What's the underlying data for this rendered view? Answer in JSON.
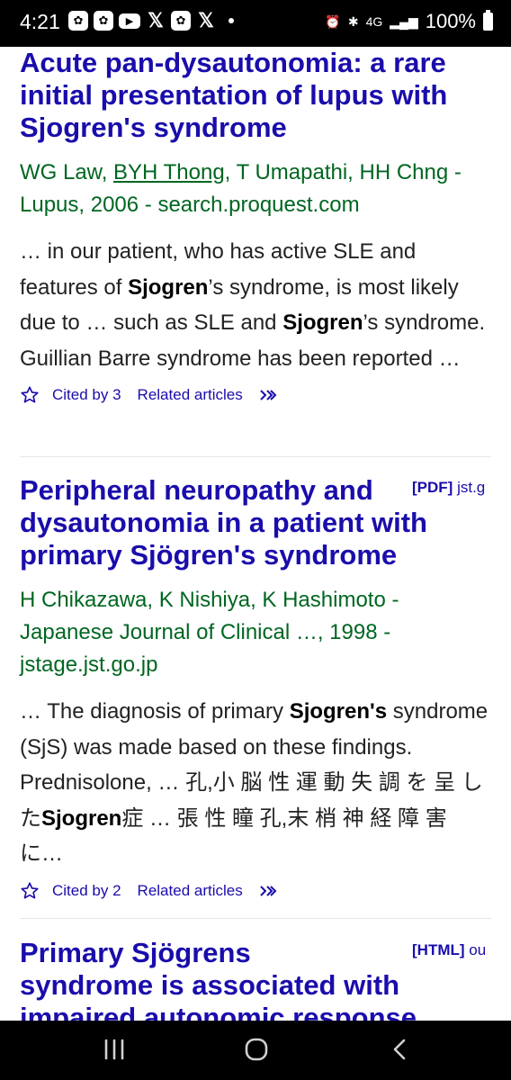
{
  "status": {
    "time": "4:21",
    "network": "4G",
    "battery": "100%"
  },
  "results": [
    {
      "title_parts": [
        "Acute pan-",
        "dysautonomia",
        ": a rare initial presentation of lupus with ",
        "Sjogren's",
        " syndrome"
      ],
      "authors_pre": "WG Law, ",
      "authors_link": "BYH Thong",
      "authors_post": ", T Umapathi, HH Chng - Lupus, 2006 - search.proquest.com",
      "snippet_parts": [
        "… in our patient, who has active SLE and features of ",
        "Sjogren",
        "’s syndrome, is most likely due to … such as SLE and ",
        "Sjogren",
        "’s syndrome. Guillian Barre syndrome has been reported …"
      ],
      "cited": "Cited by 3",
      "related": "Related articles"
    },
    {
      "tag_type": "[PDF]",
      "tag_source": "jst.g",
      "title_parts": [
        "Peripheral neuropathy and ",
        "dysautonomia",
        " in a patient with primary ",
        "Sjögren's",
        " syndrome"
      ],
      "authors": "H Chikazawa, K Nishiya, K Hashimoto - Japanese Journal of Clinical …, 1998 - jstage.jst.go.jp",
      "snippet_parts": [
        "… The diagnosis of primary ",
        "Sjogren's",
        " syndrome (SjS) was made based on these findings. Prednisolone, … 孔,小 脳 性 運 動 失 調 を 呈 し た",
        "Sjogren",
        "症 … 張 性 瞳 孔,末 梢 神 経 障 害 に…"
      ],
      "cited": "Cited by 2",
      "related": "Related articles"
    },
    {
      "tag_type": "[HTML]",
      "tag_source": "ou",
      "title_parts": [
        "Primary ",
        "Sjögrens",
        " syndrome is associated with impaired autonomic response"
      ]
    }
  ]
}
